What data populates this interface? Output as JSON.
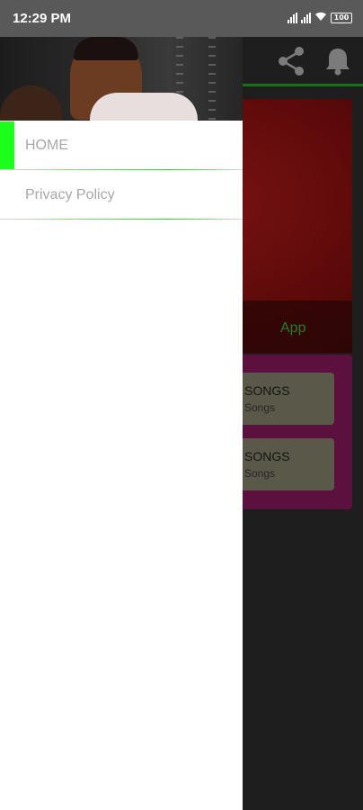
{
  "status_bar": {
    "time": "12:29 PM",
    "battery": "100"
  },
  "app_bar": {
    "share_icon": "share-icon",
    "notifications_icon": "bell-icon"
  },
  "background_content": {
    "banner_caption": "App",
    "song_cards": [
      {
        "title": "SONGS",
        "subtitle": "Songs"
      },
      {
        "title": "SONGS",
        "subtitle": "Songs"
      }
    ]
  },
  "drawer": {
    "menu_items": [
      {
        "label": "HOME",
        "active": true
      },
      {
        "label": "Privacy Policy",
        "active": false
      }
    ]
  },
  "colors": {
    "accent_green": "#1bff1b",
    "divider_green": "#29d529",
    "panel_magenta": "#8c1a5e",
    "banner_red": "#b81c1c"
  }
}
